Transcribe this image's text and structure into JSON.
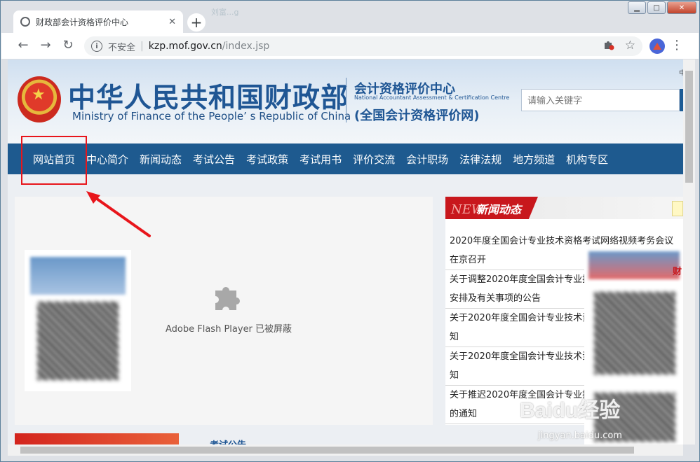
{
  "browser": {
    "tab_title": "财政部会计资格评价中心",
    "tab_close": "✕",
    "new_tab": "+",
    "background_tab_text": "刘富...g",
    "security_label": "不安全",
    "url_host": "kzp.mof.gov.cn",
    "url_path": "/index.jsp",
    "window_buttons": {
      "minimize": "▁",
      "maximize": "□",
      "close": "✕"
    },
    "icons": {
      "back": "back-arrow-icon",
      "forward": "forward-arrow-icon",
      "reload": "reload-icon",
      "info": "info-icon",
      "extension": "extension-icon",
      "star": "star-icon",
      "profile": "profile-icon",
      "menu": "kebab-menu-icon"
    }
  },
  "site": {
    "cn_title": "中华人民共和国财政部",
    "en_title": "Ministry of Finance of the People’ s Republic of China",
    "center_name": "会计资格评价中心",
    "center_en": "National Accountant Assessment & Certification Centre",
    "center_net": "(全国会计资格评价网)",
    "search_placeholder": "请输入关键字",
    "top_right_text": "中",
    "nav": [
      "网站首页",
      "中心简介",
      "新闻动态",
      "考试公告",
      "考试政策",
      "考试用书",
      "评价交流",
      "会计职场",
      "法律法规",
      "地方频道",
      "机构专区"
    ],
    "flash_message": "Adobe Flash Player 已被屏蔽",
    "news_heading_prefix": "NEW",
    "news_heading": "新闻动态",
    "news": [
      "2020年度全国会计专业技术资格考试网络视频考务会议在京召开",
      "关于调整2020年度全国会计专业技术资格考试有关工作安排及有关事项的公告",
      "关于2020年度全国会计专业技术资格考试有关问题的通知",
      "关于2020年度全国会计专业技术资格考试有关问题的通知",
      "关于推迟2020年度全国会计专业技术资格考试有关事项的通知"
    ],
    "exam_section_label": "考试公告",
    "right_panel_text": "财"
  },
  "watermark": {
    "main": "Baidu经验",
    "sub": "jingyan.baidu.com"
  },
  "colors": {
    "nav_bg": "#1e5a8f",
    "title_blue": "#1f5694",
    "highlight_red": "#e8151b",
    "news_red": "#c8171c"
  }
}
